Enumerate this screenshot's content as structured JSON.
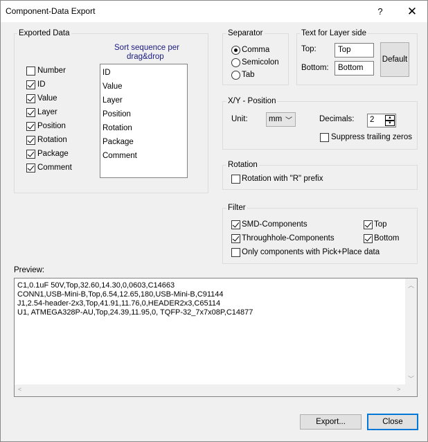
{
  "window": {
    "title": "Component-Data Export",
    "help_glyph": "?",
    "close_glyph": "✕"
  },
  "exported_data": {
    "label": "Exported Data",
    "sort_hint_line1": "Sort sequence per",
    "sort_hint_line2": "drag&drop",
    "fields": [
      {
        "label": "Number",
        "checked": false
      },
      {
        "label": "ID",
        "checked": true
      },
      {
        "label": "Value",
        "checked": true
      },
      {
        "label": "Layer",
        "checked": true
      },
      {
        "label": "Position",
        "checked": true
      },
      {
        "label": "Rotation",
        "checked": true
      },
      {
        "label": "Package",
        "checked": true
      },
      {
        "label": "Comment",
        "checked": true
      }
    ],
    "sort_list": [
      "ID",
      "Value",
      "Layer",
      "Position",
      "Rotation",
      "Package",
      "Comment"
    ]
  },
  "separator": {
    "label": "Separator",
    "options": [
      {
        "label": "Comma",
        "selected": true
      },
      {
        "label": "Semicolon",
        "selected": false
      },
      {
        "label": "Tab",
        "selected": false
      }
    ]
  },
  "layer_side": {
    "label": "Text for Layer side",
    "top_label": "Top:",
    "top_value": "Top",
    "bottom_label": "Bottom:",
    "bottom_value": "Bottom",
    "default_button": "Default"
  },
  "xy_position": {
    "label": "X/Y - Position",
    "unit_label": "Unit:",
    "unit_value": "mm",
    "decimals_label": "Decimals:",
    "decimals_value": "2",
    "suppress_label": "Suppress trailing zeros",
    "suppress_checked": false
  },
  "rotation": {
    "label": "Rotation",
    "prefix_label": "Rotation with \"R\" prefix",
    "prefix_checked": false
  },
  "filter": {
    "label": "Filter",
    "smd_label": "SMD-Components",
    "smd_checked": true,
    "th_label": "Throughhole-Components",
    "th_checked": true,
    "top_label": "Top",
    "top_checked": true,
    "bottom_label": "Bottom",
    "bottom_checked": true,
    "pnp_label": "Only components with Pick+Place data",
    "pnp_checked": false
  },
  "preview": {
    "label": "Preview:",
    "lines": [
      "C1,0.1uF 50V,Top,32.60,14.30,0,0603,C14663",
      "CONN1,USB-Mini-B,Top,6.54,12.65,180,USB-Mini-B,C91144",
      "J1,2.54-header-2x3,Top,41.91,11.76,0,HEADER2x3,C65114",
      "U1, ATMEGA328P-AU,Top,24.39,11.95,0, TQFP-32_7x7x08P,C14877"
    ]
  },
  "buttons": {
    "export": "Export...",
    "close": "Close"
  }
}
